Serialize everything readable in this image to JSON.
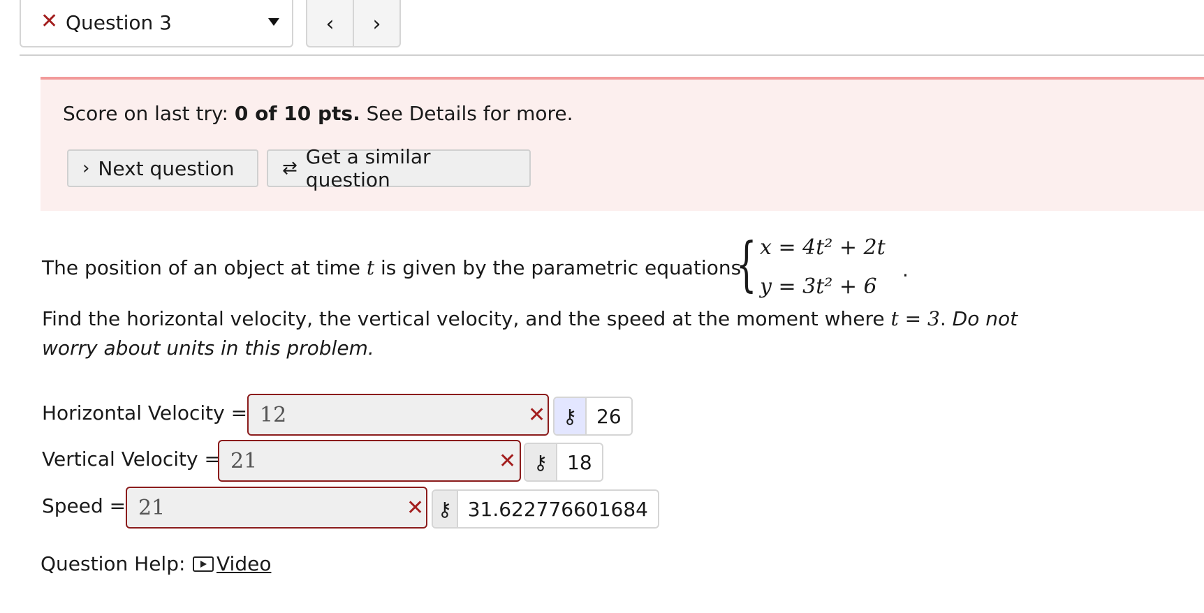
{
  "nav": {
    "question_label": "Question 3",
    "prev": "‹",
    "next": "›",
    "status_icon": "close-icon"
  },
  "banner": {
    "score_prefix": "Score on last try: ",
    "score_value": "0 of 10 pts.",
    "score_suffix": " See Details for more.",
    "next_question": "Next question",
    "similar_question": "Get a similar question"
  },
  "problem": {
    "intro": "The position of an object at time ",
    "var_t": "t",
    "intro_rest": " is given by the parametric equations",
    "eq_x": "x = 4t² + 2t",
    "eq_y": "y = 3t² + 6",
    "find": "Find the horizontal velocity, the vertical velocity, and the speed at the moment where ",
    "t_eq": "t = 3",
    "find_end": ". ",
    "note": "Do not worry about units in this problem."
  },
  "answers": [
    {
      "label": "Horizontal Velocity =",
      "entered": "12",
      "correct": "26"
    },
    {
      "label": "Vertical Velocity =",
      "entered": "21",
      "correct": "18"
    },
    {
      "label": "Speed =",
      "entered": "21",
      "correct": "31.622776601684"
    }
  ],
  "help": {
    "label": "Question Help:",
    "video": "Video"
  },
  "colors": {
    "error": "#a31e1e",
    "banner_bg": "#fcefee",
    "banner_border": "#f29a9a"
  }
}
